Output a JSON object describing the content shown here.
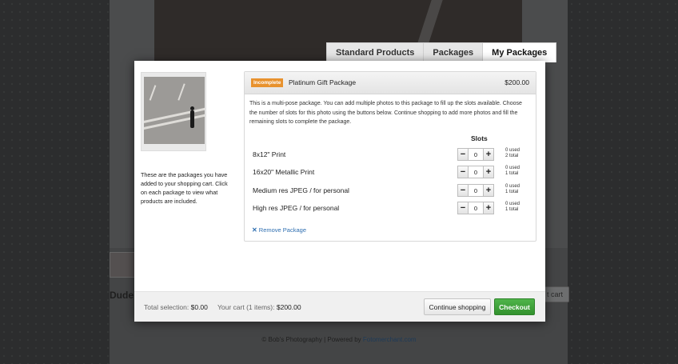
{
  "background": {
    "title": "Dude",
    "cart_button": "t cart",
    "copyright": "© Bob's Photography | Powered by",
    "powered_link": "Fotomerchant.com"
  },
  "tabs": [
    {
      "label": "Standard Products"
    },
    {
      "label": "Packages"
    },
    {
      "label": "My Packages"
    }
  ],
  "sidebar": {
    "text": "These are the packages you have added to your shopping cart. Click on each package to view what products are included."
  },
  "package": {
    "status": "Incomplete",
    "name": "Platinum Gift Package",
    "price": "$200.00",
    "description": "This is a multi-pose package. You can add multiple photos to this package to fill up the slots available. Choose the number of slots for this photo using the buttons below. Continue shopping to add more photos and fill the remaining slots to complete the package.",
    "slots_title": "Slots",
    "slots": [
      {
        "label": "8x12\" Print",
        "value": "0",
        "used": "0 used",
        "total": "2 total"
      },
      {
        "label": "16x20\" Metallic Print",
        "value": "0",
        "used": "0 used",
        "total": "1 total"
      },
      {
        "label": "Medium res JPEG / for personal",
        "value": "0",
        "used": "0 used",
        "total": "1 total"
      },
      {
        "label": "High res JPEG / for personal",
        "value": "0",
        "used": "0 used",
        "total": "1 total"
      }
    ],
    "remove_label": "Remove Package"
  },
  "footer": {
    "total_selection_label": "Total selection:",
    "total_selection_value": "$0.00",
    "cart_label": "Your cart (1 items):",
    "cart_value": "$200.00",
    "continue_label": "Continue shopping",
    "checkout_label": "Checkout"
  },
  "colors": {
    "badge": "#e8922e",
    "checkout": "#3a9e35",
    "link": "#2f6fb1"
  }
}
